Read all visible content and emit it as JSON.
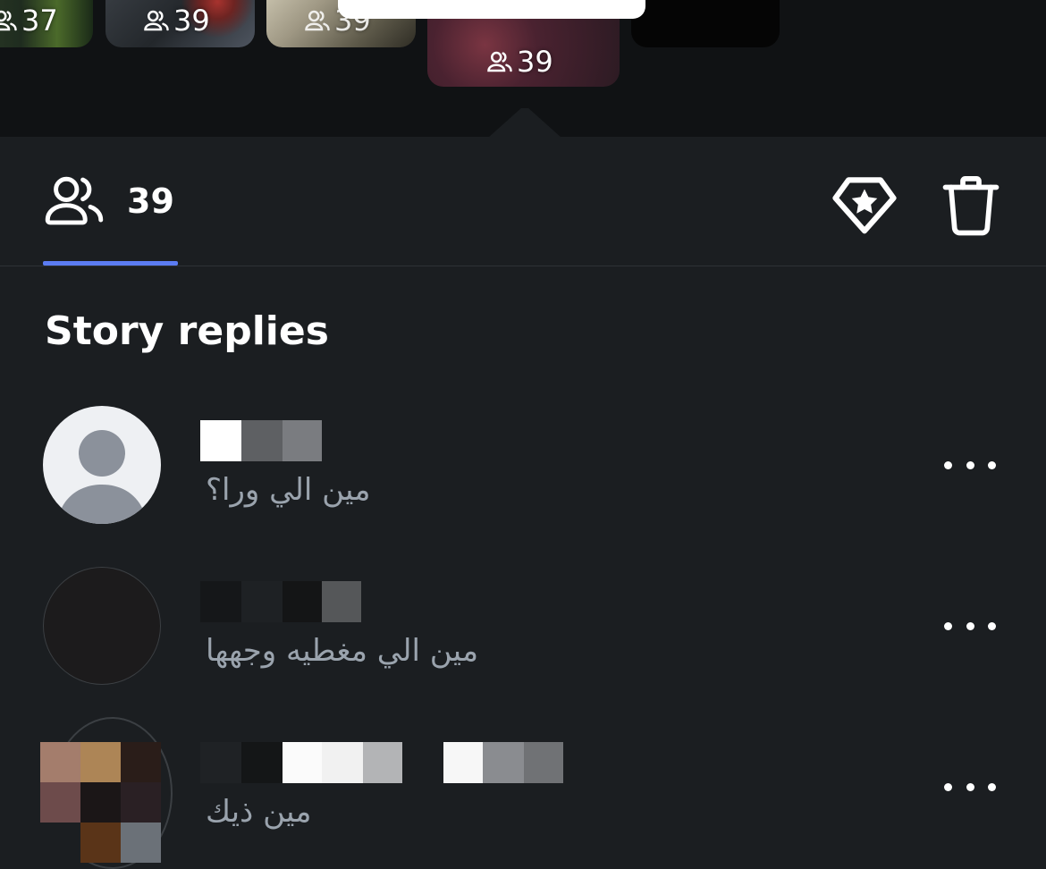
{
  "strip": {
    "thumbnails": [
      {
        "count": "37"
      },
      {
        "count": "39"
      },
      {
        "count": "39"
      },
      {
        "count": "39"
      }
    ]
  },
  "header": {
    "viewer_count": "39",
    "icons": [
      "people-icon",
      "highlight-diamond-star-icon",
      "trash-icon"
    ],
    "accent_color": "#5b7cf2"
  },
  "section": {
    "title": "Story replies"
  },
  "replies": [
    {
      "text": "مين الي ورا؟",
      "avatar": "default-avatar-icon"
    },
    {
      "text": "مين الي مغطيه وجهها",
      "avatar": "dark-avatar"
    },
    {
      "text": "مين ذيك",
      "avatar": "photo-avatar"
    }
  ],
  "colors": {
    "background": "#1b1e21",
    "strip_background": "#101214",
    "secondary_text": "#9aa3ad",
    "divider": "#2e3236"
  }
}
